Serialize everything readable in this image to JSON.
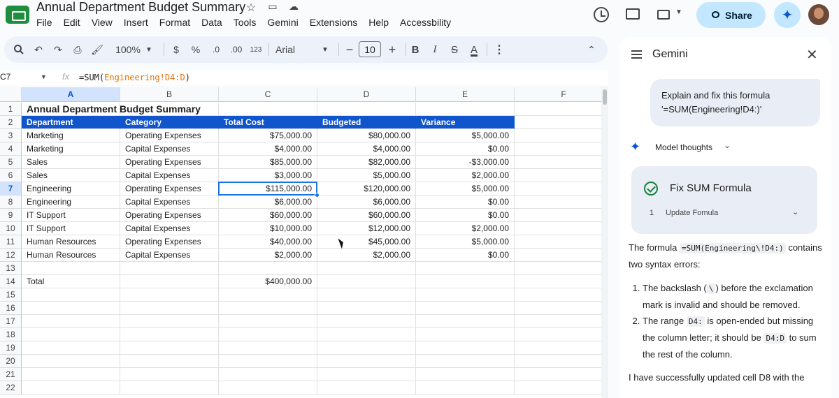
{
  "app": {
    "title": "Annual Department Budget Summary",
    "menu": [
      "File",
      "Edit",
      "View",
      "Insert",
      "Format",
      "Data",
      "Tools",
      "Gemini",
      "Extensions",
      "Help",
      "Accessbility"
    ],
    "share_label": "Share",
    "colors": {
      "accent": "#1155cc",
      "share_bg": "#c2e7ff",
      "selection": "#1a73e8"
    }
  },
  "toolbar": {
    "zoom": "100%",
    "font": "Arial",
    "font_size": "10",
    "currency": "$",
    "percent": "%",
    "dec_decrease": ".0",
    "dec_increase": ".00",
    "number_format": "123",
    "bold": "B",
    "italic": "I",
    "strike": "S",
    "text_color": "A"
  },
  "formula_bar": {
    "cell_ref": "C7",
    "fx": "fx",
    "formula_prefix": "=SUM(",
    "formula_ref": "Engineering!D4:D",
    "formula_suffix": ")"
  },
  "sheet": {
    "columns": [
      "A",
      "B",
      "C",
      "D",
      "E",
      "F"
    ],
    "rows": [
      "1",
      "2",
      "3",
      "4",
      "5",
      "6",
      "7",
      "8",
      "9",
      "10",
      "11",
      "12",
      "13",
      "14",
      "15",
      "16",
      "17",
      "18",
      "19",
      "20",
      "21",
      "22"
    ],
    "title": "Annual Department Budget Summary",
    "headers": [
      "Department",
      "Category",
      "Total Cost",
      "Budgeted",
      "Variance"
    ],
    "data": [
      [
        "Marketing",
        "Operating Expenses",
        "$75,000.00",
        "$80,000.00",
        "$5,000.00"
      ],
      [
        "Marketing",
        "Capital Expenses",
        "$4,000.00",
        "$4,000.00",
        "$0.00"
      ],
      [
        "Sales",
        "Operating Expenses",
        "$85,000.00",
        "$82,000.00",
        "-$3,000.00"
      ],
      [
        "Sales",
        "Capital Expenses",
        "$3,000.00",
        "$5,000.00",
        "$2,000.00"
      ],
      [
        "Engineering",
        "Operating Expenses",
        "$115,000.00",
        "$120,000.00",
        "$5,000.00"
      ],
      [
        "Engineering",
        "Capital Expenses",
        "$6,000.00",
        "$6,000.00",
        "$0.00"
      ],
      [
        "IT Support",
        "Operating Expenses",
        "$60,000.00",
        "$60,000.00",
        "$0.00"
      ],
      [
        "IT Support",
        "Capital Expenses",
        "$10,000.00",
        "$12,000.00",
        "$2,000.00"
      ],
      [
        "Human Resources",
        "Operating Expenses",
        "$40,000.00",
        "$45,000.00",
        "$5,000.00"
      ],
      [
        "Human Resources",
        "Capital Expenses",
        "$2,000.00",
        "$2,000.00",
        "$0.00"
      ]
    ],
    "total_label": "Total",
    "total_value": "$400,000.00"
  },
  "gemini": {
    "title": "Gemini",
    "user_message": "Explain and fix this formula '=SUM(Engineering!D4:)'",
    "thoughts_label": "Model thoughts",
    "card_title": "Fix SUM Formula",
    "step_number": "1",
    "step_label": "Update Fomula",
    "resp_intro_a": "The formula",
    "resp_code1": "=SUM(Engineering\\!D4:)",
    "resp_intro_b": "contains two syntax errors:",
    "item1_a": "The backslash (",
    "item1_code": "\\",
    "item1_b": ") before the exclamation mark is invalid and should be removed.",
    "item2_a": "The range",
    "item2_code": "D4:",
    "item2_b": "is open-ended but missing the column letter; it should be",
    "item2_code2": "D4:D",
    "item2_c": "to sum the rest of the column.",
    "resp_last": "I have successfully updated cell D8 with the"
  }
}
